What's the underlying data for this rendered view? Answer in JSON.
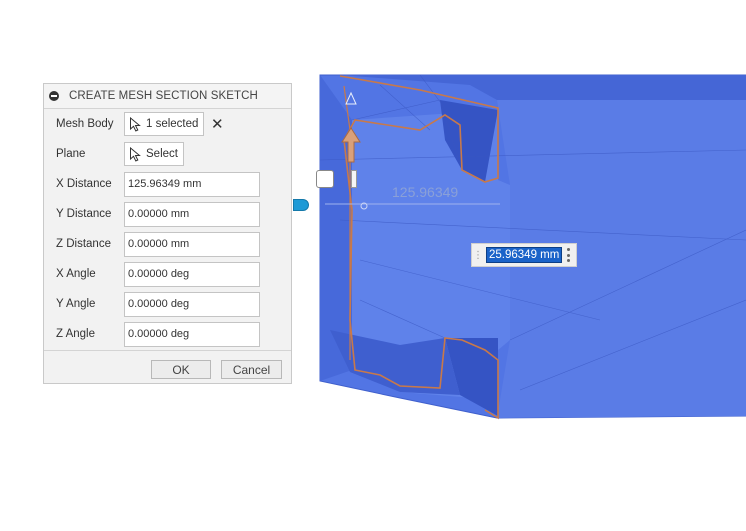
{
  "dialog": {
    "title": "CREATE MESH SECTION SKETCH",
    "mesh_body": {
      "label": "Mesh Body",
      "button": "1 selected"
    },
    "plane": {
      "label": "Plane",
      "button": "Select"
    },
    "fields": [
      {
        "label": "X Distance",
        "value": "125.96349 mm"
      },
      {
        "label": "Y Distance",
        "value": "0.00000 mm"
      },
      {
        "label": "Z Distance",
        "value": "0.00000 mm"
      },
      {
        "label": "X Angle",
        "value": "0.00000 deg"
      },
      {
        "label": "Y Angle",
        "value": "0.00000 deg"
      },
      {
        "label": "Z Angle",
        "value": "0.00000 deg"
      }
    ],
    "ok_label": "OK",
    "cancel_label": "Cancel"
  },
  "viewport": {
    "ghost_dimension": "125.96349",
    "dimension_input": "25.96349 mm",
    "mesh_color": "#4d6fe0",
    "section_color": "#c8794a",
    "accent_color": "#1a63c9"
  }
}
